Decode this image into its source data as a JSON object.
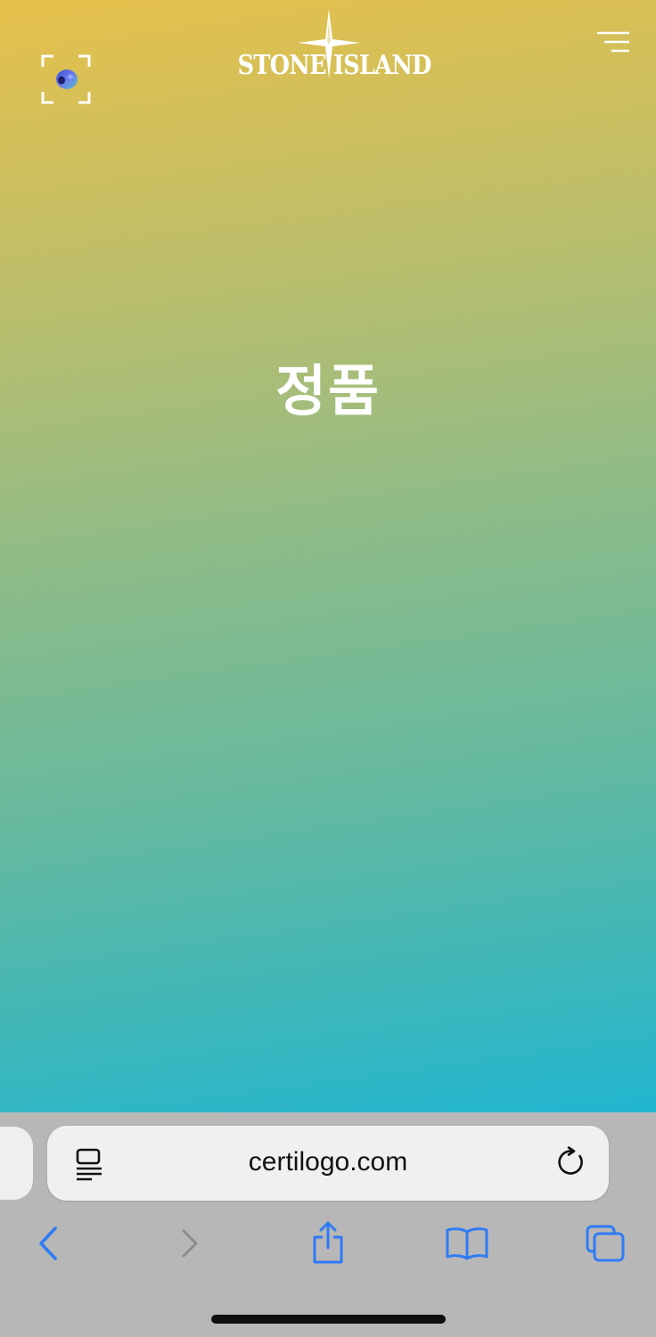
{
  "header": {
    "brand_name": "STONE ISLAND",
    "icons": {
      "left": "scan-frame-icon",
      "logo": "compass-star-icon",
      "right": "menu-icon"
    }
  },
  "main": {
    "headline": "정품"
  },
  "colors": {
    "gradient_top": "#e6c04a",
    "gradient_mid": "#86bb8c",
    "gradient_bottom": "#22b6d0",
    "browser_chrome": "#b7b7b7",
    "address_bar": "#f0f0f0",
    "ios_blue": "#2f7bf5"
  },
  "browser": {
    "url": "certilogo.com",
    "address_icons": {
      "left": "reader-mode-icon",
      "right": "reload-icon"
    },
    "toolbar": [
      "back-icon",
      "forward-icon",
      "share-icon",
      "bookmarks-icon",
      "tabs-icon"
    ]
  }
}
